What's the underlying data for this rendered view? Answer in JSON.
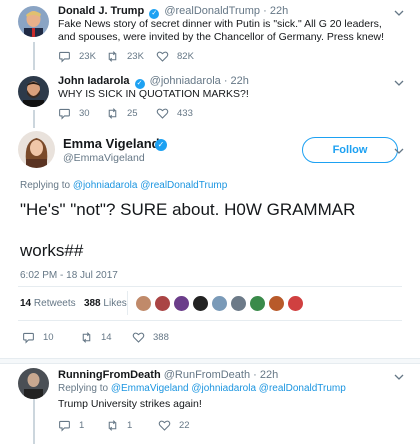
{
  "tweet1": {
    "name": "Donald J. Trump",
    "handle": "@realDonaldTrump",
    "time": "· 22h",
    "text": "Fake News story of secret dinner with Putin is \"sick.\" All G 20 leaders, and spouses, were invited by the Chancellor of Germany. Press knew!",
    "replies": "23K",
    "retweets": "23K",
    "likes": "82K"
  },
  "tweet2": {
    "name": "John Iadarola",
    "handle": "@johniadarola",
    "time": "· 22h",
    "text": "WHY IS SICK IN QUOTATION MARKS?!",
    "replies": "30",
    "retweets": "25",
    "likes": "433"
  },
  "main_tweet": {
    "name": "Emma Vigeland",
    "handle": "@EmmaVigeland",
    "follow_label": "Follow",
    "replying_prefix": "Replying to",
    "replying_to": "@johniadarola @realDonaldTrump",
    "text_line1": "\"He's\" \"not\"? SURE about. H0W GRAMMAR",
    "text_line2": "works##",
    "timestamp": "6:02 PM - 18 Jul 2017",
    "retweets_count": "14",
    "retweets_label": "Retweets",
    "likes_count": "388",
    "likes_label": "Likes",
    "replies": "10",
    "retweets": "14",
    "likes": "388"
  },
  "tweet4": {
    "name": "RunningFromDeath",
    "handle": "@RunFromDeath",
    "time": "· 22h",
    "replying_prefix": "Replying to",
    "replying_to": "@EmmaVigeland @johniadarola @realDonaldTrump",
    "text": "Trump University strikes again!",
    "replies": "1",
    "retweets": "1",
    "likes": "22"
  },
  "colors": {
    "accent": "#1da1f2",
    "link": "#1b95e0",
    "muted": "#657786"
  }
}
